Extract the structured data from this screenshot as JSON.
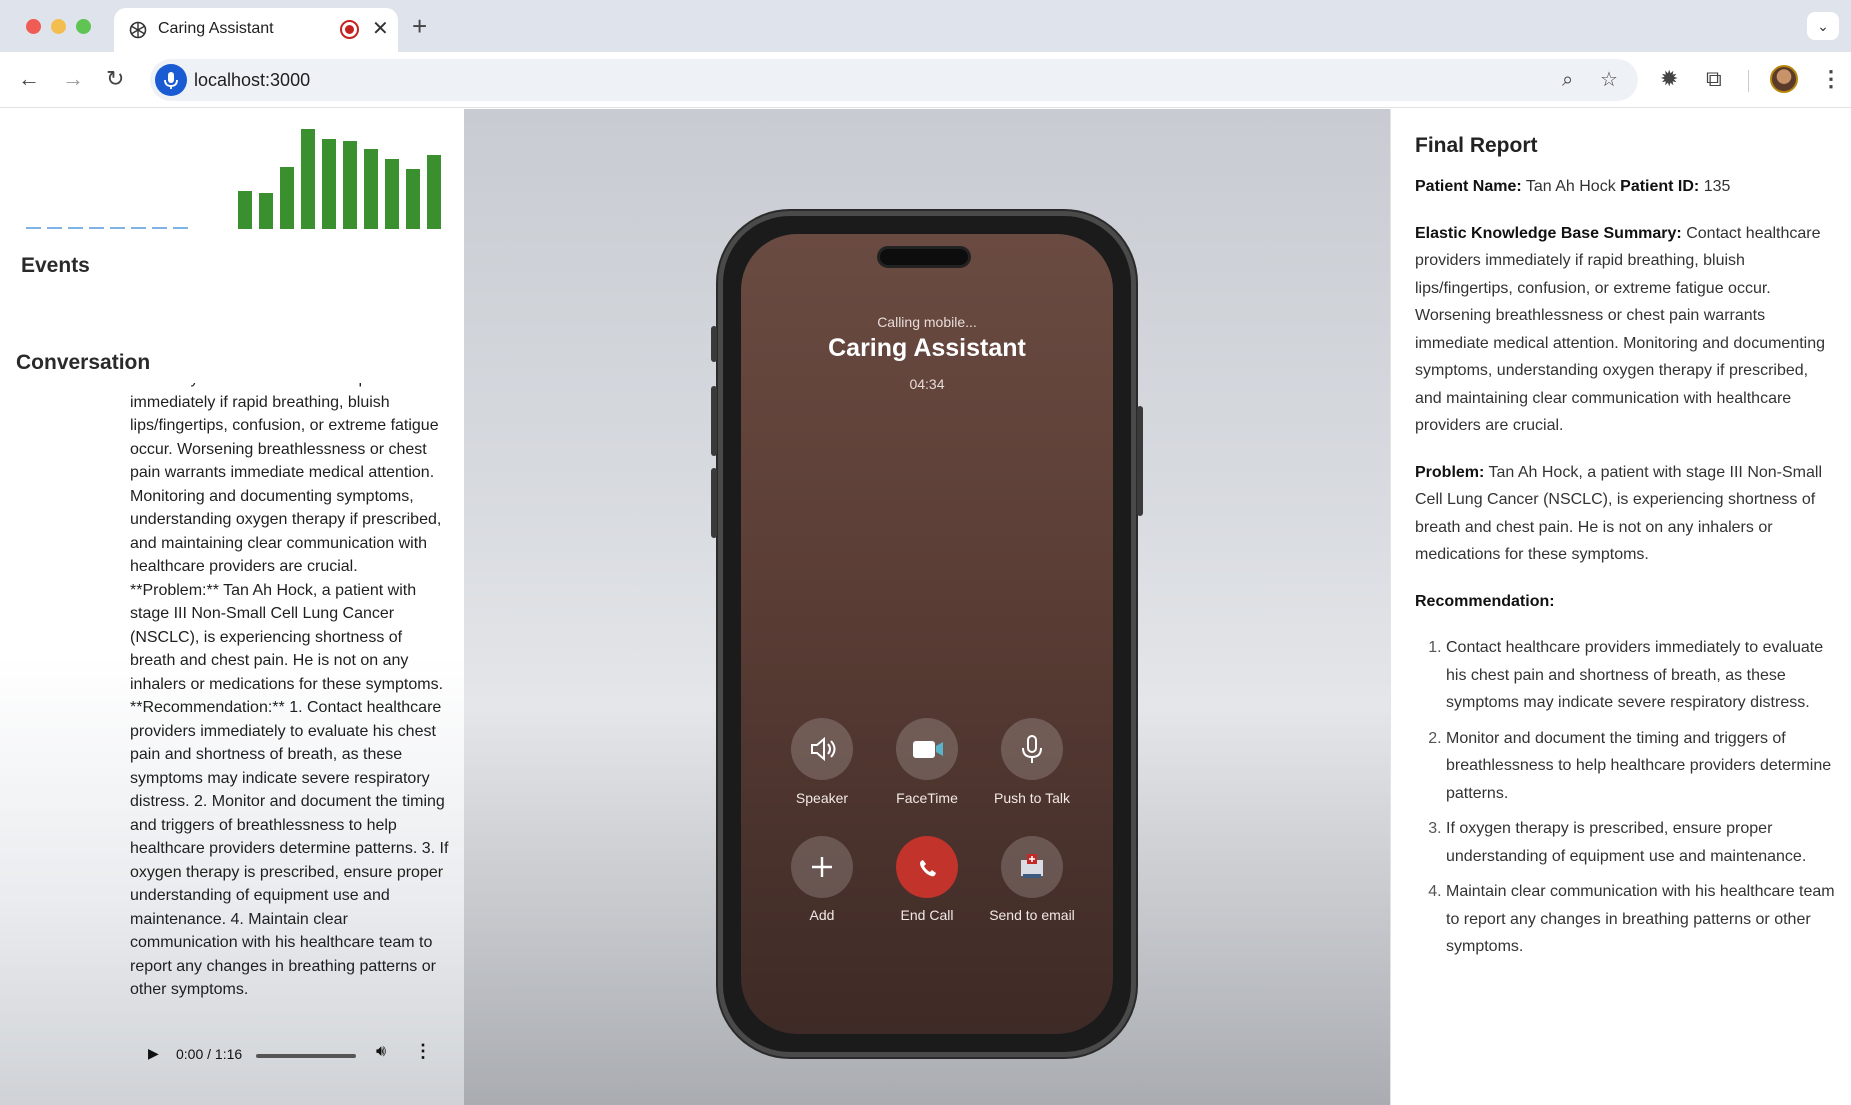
{
  "browser": {
    "tab_title": "Caring Assistant",
    "url": "localhost:3000",
    "icons": [
      "back-arrow-icon",
      "forward-arrow-icon",
      "reload-icon",
      "microphone-icon",
      "zoom-icon",
      "bookmark-star-icon",
      "extension-gear-icon",
      "extensions-puzzle-icon",
      "menu-dots-icon"
    ]
  },
  "left": {
    "events_heading": "Events",
    "conversation_heading": "Conversation",
    "conversation_text": "Summary:** Contact healthcare providers immediately if rapid breathing, bluish lips/fingertips, confusion, or extreme fatigue occur. Worsening breathlessness or chest pain warrants immediate medical attention. Monitoring and documenting symptoms, understanding oxygen therapy if prescribed, and maintaining clear communication with healthcare providers are crucial. **Problem:** Tan Ah Hock, a patient with stage III Non-Small Cell Lung Cancer (NSCLC), is experiencing shortness of breath and chest pain. He is not on any inhalers or medications for these symptoms. **Recommendation:** 1. Contact healthcare providers immediately to evaluate his chest pain and shortness of breath, as these symptoms may indicate severe respiratory distress. 2. Monitor and document the timing and triggers of breathlessness to help healthcare providers determine patterns. 3. If oxygen therapy is prescribed, ensure proper understanding of equipment use and maintenance. 4. Maintain clear communication with his healthcare team to report any changes in breathing patterns or other symptoms.",
    "audio_time": "0:00 / 1:16",
    "visualizer": {
      "idle_bar_color": "#7fb3e6",
      "active_bar_color": "#3a8f2e",
      "idle_bars": 8,
      "active_levels": [
        0.38,
        0.36,
        0.62,
        1.0,
        0.9,
        0.88,
        0.8,
        0.7,
        0.6,
        0.74
      ]
    }
  },
  "call": {
    "status": "Calling mobile...",
    "caller": "Caring Assistant",
    "duration": "04:34",
    "buttons": [
      {
        "label": "Speaker",
        "icon": "speaker-icon"
      },
      {
        "label": "FaceTime",
        "icon": "facetime-icon"
      },
      {
        "label": "Push to Talk",
        "icon": "microphone-icon"
      },
      {
        "label": "Add",
        "icon": "plus-icon"
      },
      {
        "label": "End Call",
        "icon": "end-call-icon"
      },
      {
        "label": "Send to email",
        "icon": "email-icon"
      }
    ],
    "end_call_color": "#c1332b"
  },
  "report": {
    "title": "Final Report",
    "patient_name_label": "Patient Name:",
    "patient_name": "Tan Ah Hock",
    "patient_id_label": "Patient ID:",
    "patient_id": "135",
    "summary_label": "Elastic Knowledge Base Summary:",
    "summary": "Contact healthcare providers immediately if rapid breathing, bluish lips/fingertips, confusion, or extreme fatigue occur. Worsening breathlessness or chest pain warrants immediate medical attention. Monitoring and documenting symptoms, understanding oxygen therapy if prescribed, and maintaining clear communication with healthcare providers are crucial.",
    "problem_label": "Problem:",
    "problem": "Tan Ah Hock, a patient with stage III Non-Small Cell Lung Cancer (NSCLC), is experiencing shortness of breath and chest pain. He is not on any inhalers or medications for these symptoms.",
    "recommendation_label": "Recommendation:",
    "recommendations": [
      "Contact healthcare providers immediately to evaluate his chest pain and shortness of breath, as these symptoms may indicate severe respiratory distress.",
      "Monitor and document the timing and triggers of breathlessness to help healthcare providers determine patterns.",
      "If oxygen therapy is prescribed, ensure proper understanding of equipment use and maintenance.",
      "Maintain clear communication with his healthcare team to report any changes in breathing patterns or other symptoms."
    ]
  }
}
